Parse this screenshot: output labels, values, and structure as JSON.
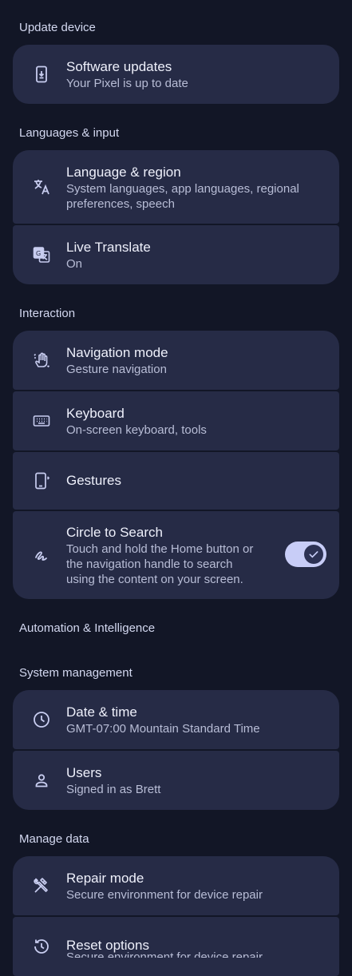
{
  "sections": {
    "update_device": "Update device",
    "languages_input": "Languages & input",
    "interaction": "Interaction",
    "automation": "Automation & Intelligence",
    "system_management": "System management",
    "manage_data": "Manage data"
  },
  "items": {
    "software_updates": {
      "title": "Software updates",
      "subtitle": "Your Pixel is up to date",
      "icon": "phone-download-icon"
    },
    "language_region": {
      "title": "Language & region",
      "subtitle": "System languages, app languages, regional preferences, speech",
      "icon": "translate-icon"
    },
    "live_translate": {
      "title": "Live Translate",
      "subtitle": "On",
      "icon": "google-translate-icon"
    },
    "navigation_mode": {
      "title": "Navigation mode",
      "subtitle": "Gesture navigation",
      "icon": "gesture-hand-icon"
    },
    "keyboard": {
      "title": "Keyboard",
      "subtitle": "On-screen keyboard, tools",
      "icon": "keyboard-icon"
    },
    "gestures": {
      "title": "Gestures",
      "icon": "phone-gesture-icon"
    },
    "circle_to_search": {
      "title": "Circle to Search",
      "subtitle": "Touch and hold the Home button or the navigation handle to search using the content on your screen.",
      "icon": "scribble-icon",
      "toggle": true
    },
    "date_time": {
      "title": "Date & time",
      "subtitle": "GMT-07:00 Mountain Standard Time",
      "icon": "clock-icon"
    },
    "users": {
      "title": "Users",
      "subtitle": "Signed in as Brett",
      "icon": "person-icon"
    },
    "repair_mode": {
      "title": "Repair mode",
      "subtitle": "Secure environment for device repair",
      "icon": "tools-icon"
    },
    "reset_options": {
      "title": "Reset options",
      "subtitle": "Secure environment for device repair",
      "icon": "history-icon"
    }
  },
  "colors": {
    "background": "#121626",
    "card": "#262b46",
    "accent": "#c8cdf7"
  }
}
